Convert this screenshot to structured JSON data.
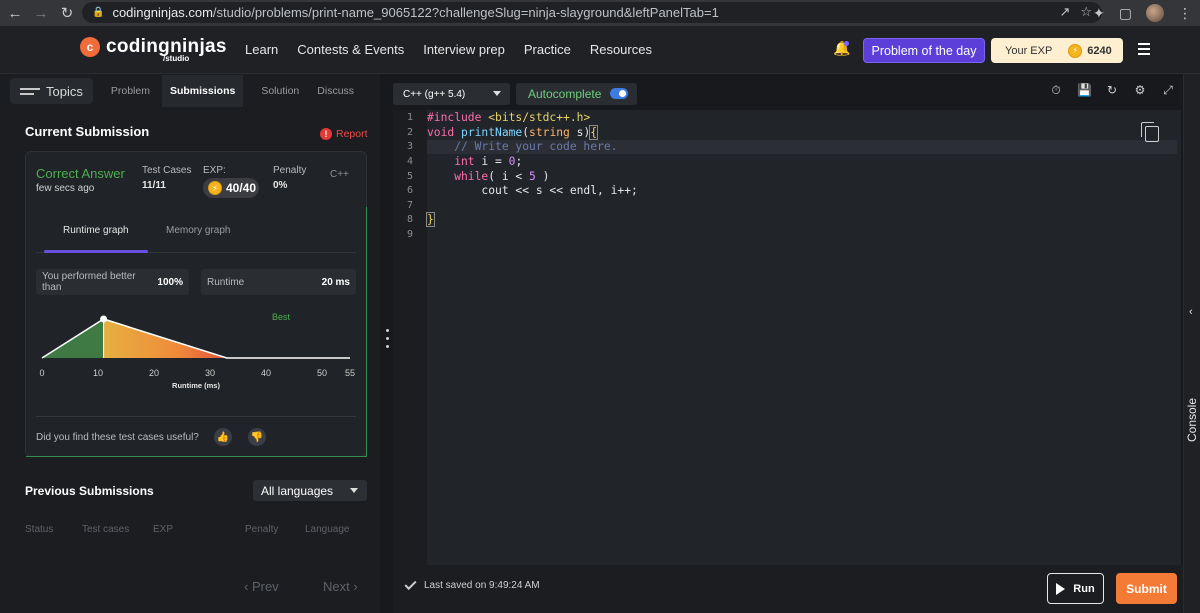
{
  "browser": {
    "url_host": "codingninjas.com",
    "url_path": "/studio/problems/print-name_9065122?challengeSlug=ninja-slayground&leftPanelTab=1"
  },
  "header": {
    "logo_text": "codingninjas",
    "logo_sub": "/studio",
    "nav": [
      "Learn",
      "Contests & Events",
      "Interview prep",
      "Practice",
      "Resources"
    ],
    "potd_label": "Problem of the day",
    "exp_label": "Your EXP",
    "exp_value": "6240"
  },
  "left_tabs": {
    "topics": "Topics",
    "problem": "Problem",
    "submissions": "Submissions",
    "solution": "Solution",
    "discuss": "Discuss"
  },
  "current_submission": {
    "title": "Current Submission",
    "report": "Report",
    "status": "Correct Answer",
    "time_ago": "few secs ago",
    "test_cases_label": "Test Cases",
    "test_cases_value": "11/11",
    "exp_label": "EXP:",
    "exp_value": "40/40",
    "penalty_label": "Penalty",
    "penalty_value": "0%",
    "language": "C++",
    "runtime_tab": "Runtime graph",
    "memory_tab": "Memory graph",
    "performed_label": "You performed better than",
    "performed_value": "100%",
    "runtime_label": "Runtime",
    "runtime_value": "20 ms",
    "useful_question": "Did you find these test cases useful?"
  },
  "chart_data": {
    "type": "area",
    "xlabel": "Runtime (ms)",
    "ylabel": "",
    "xticks": [
      0,
      10,
      20,
      30,
      40,
      50,
      55
    ],
    "xlim": [
      0,
      55
    ],
    "x": [
      0,
      11,
      33,
      55
    ],
    "y": [
      0,
      1,
      0,
      0
    ],
    "highlight_x": 11,
    "legend": "Best"
  },
  "previous_submissions": {
    "title": "Previous Submissions",
    "language_select": "All languages",
    "columns": [
      "Status",
      "Test cases",
      "EXP",
      "Penalty",
      "Language"
    ],
    "prev": "Prev",
    "next": "Next"
  },
  "editor": {
    "language": "C++ (g++ 5.4)",
    "autocomplete": "Autocomplete",
    "autocomplete_enabled": true,
    "line_numbers": [
      "1",
      "2",
      "3",
      "4",
      "5",
      "6",
      "7",
      "8",
      "9"
    ]
  },
  "code": {
    "l1_kw": "#include",
    "l1_str": " <bits/stdc++.h>",
    "l2_kw": "void",
    "l2_fn": " printName",
    "l2_p1": "(",
    "l2_typ": "string",
    "l2_p2": " s)",
    "l2_br": "{",
    "l3_cmt": "    // Write your code here.",
    "l4_kw": "    int",
    "l4_rest": " i = ",
    "l4_num": "0",
    "l4_end": ";",
    "l5_kw": "    while",
    "l5_rest": "( i < ",
    "l5_num": "5",
    "l5_end": " )",
    "l6_text": "        cout << s << endl, i++;",
    "l8_br": "}"
  },
  "footer": {
    "saved_text": "Last saved on 9:49:24 AM",
    "run": "Run",
    "submit": "Submit"
  },
  "console": {
    "label": "Console"
  },
  "colors": {
    "accent_purple": "#5b3fd8",
    "correct_green": "#4caf50",
    "submit_orange": "#f47b36"
  }
}
